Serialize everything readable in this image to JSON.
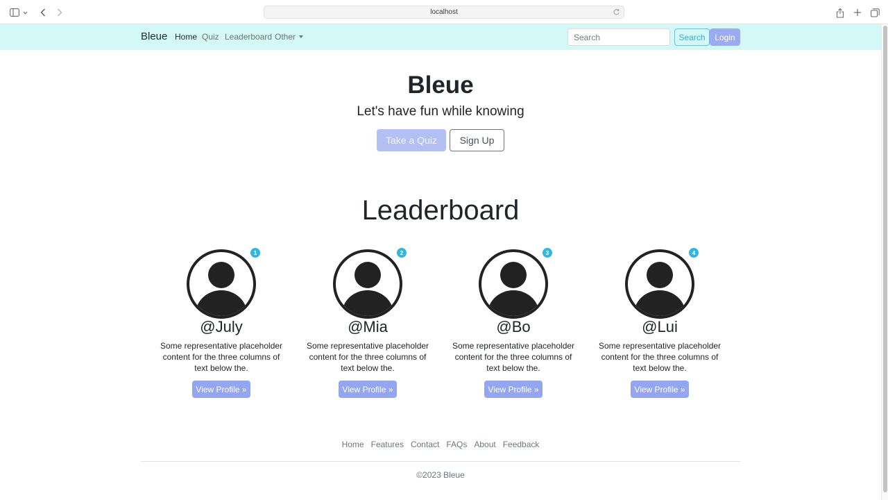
{
  "browser": {
    "url": "localhost"
  },
  "navbar": {
    "brand": "Bleue",
    "links": [
      {
        "label": "Home",
        "active": true
      },
      {
        "label": "Quiz",
        "active": false
      },
      {
        "label": "Leaderboard",
        "active": false
      },
      {
        "label": "Other",
        "active": false
      }
    ],
    "search_placeholder": "Search",
    "search_button": "Search",
    "login_button": "Login"
  },
  "hero": {
    "title": "Bleue",
    "tagline": "Let's have fun while knowing",
    "primary_button": "Take a Quiz",
    "secondary_button": "Sign Up"
  },
  "leaderboard": {
    "title": "Leaderboard",
    "users": [
      {
        "rank": "1",
        "handle": "@July",
        "description": "Some representative placeholder content for the three columns of text below the.",
        "button": "View Profile »"
      },
      {
        "rank": "2",
        "handle": "@Mia",
        "description": "Some representative placeholder content for the three columns of text below the.",
        "button": "View Profile »"
      },
      {
        "rank": "3",
        "handle": "@Bo",
        "description": "Some representative placeholder content for the three columns of text below the.",
        "button": "View Profile »"
      },
      {
        "rank": "4",
        "handle": "@Lui",
        "description": "Some representative placeholder content for the three columns of text below the.",
        "button": "View Profile »"
      }
    ]
  },
  "footer": {
    "links": [
      "Home",
      "Features",
      "Contact",
      "FAQs",
      "About",
      "Feedback"
    ],
    "copyright": "©2023 Bleue"
  },
  "colors": {
    "navbar_bg": "#d4f8f6",
    "primary": "#95a6f1",
    "info": "#33b6e0"
  }
}
